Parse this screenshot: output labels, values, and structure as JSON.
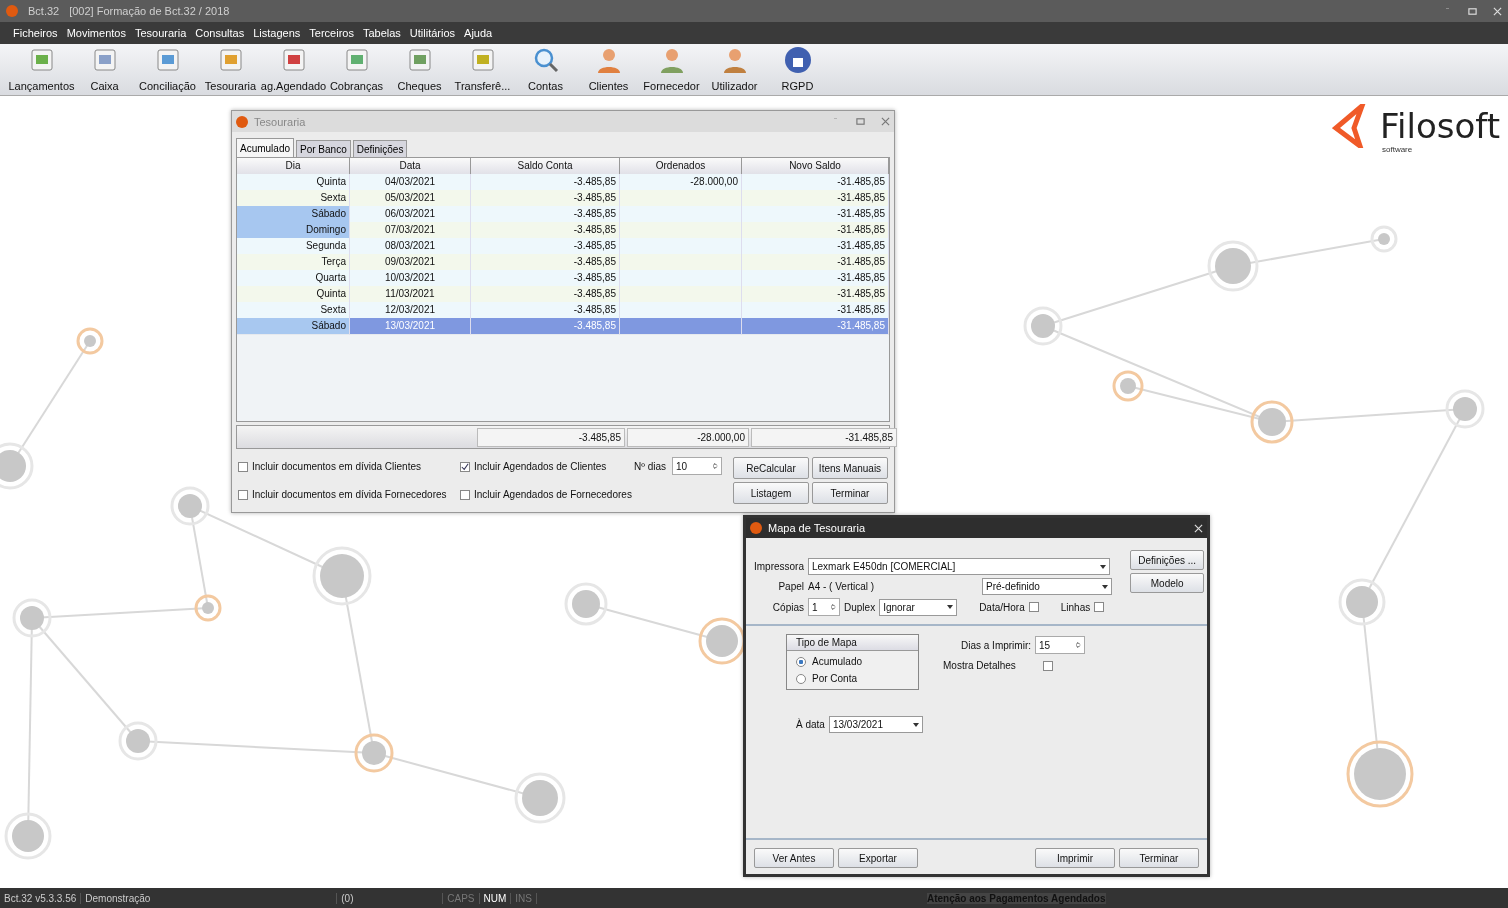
{
  "app_title": {
    "app": "Bct.32",
    "company": "[002]  Formação de Bct.32 / 2018"
  },
  "menu": [
    "Ficheiros",
    "Movimentos",
    "Tesouraria",
    "Consultas",
    "Listagens",
    "Terceiros",
    "Tabelas",
    "Utilitários",
    "Ajuda"
  ],
  "toolbar": [
    "Lançamentos",
    "Caixa",
    "Conciliação",
    "Tesouraria",
    "ag.Agendado",
    "Cobranças",
    "Cheques",
    "Transferê...",
    "Contas",
    "Clientes",
    "Fornecedor",
    "Utilizador",
    "RGPD"
  ],
  "logo": {
    "name": "Filosoft",
    "tagline": "software"
  },
  "tesouraria": {
    "title": "Tesouraria",
    "tabs": [
      {
        "label": "Acumulado",
        "selected": true
      },
      {
        "label": "Por Banco",
        "selected": false
      },
      {
        "label": "Definições",
        "selected": false
      }
    ],
    "columns": [
      "Dia",
      "Data",
      "Saldo Conta",
      "Ordenados",
      "Novo Saldo"
    ],
    "rows": [
      {
        "dia": "Quinta",
        "data": "04/03/2021",
        "saldo": "-3.485,85",
        "ordenados": "-28.000,00",
        "novo": "-31.485,85",
        "weekend": false,
        "selected": false
      },
      {
        "dia": "Sexta",
        "data": "05/03/2021",
        "saldo": "-3.485,85",
        "novo": "-31.485,85",
        "weekend": false,
        "selected": false
      },
      {
        "dia": "Sábado",
        "data": "06/03/2021",
        "saldo": "-3.485,85",
        "novo": "-31.485,85",
        "weekend": true,
        "selected": false
      },
      {
        "dia": "Domingo",
        "data": "07/03/2021",
        "saldo": "-3.485,85",
        "novo": "-31.485,85",
        "weekend": true,
        "selected": false
      },
      {
        "dia": "Segunda",
        "data": "08/03/2021",
        "saldo": "-3.485,85",
        "novo": "-31.485,85",
        "weekend": false,
        "selected": false
      },
      {
        "dia": "Terça",
        "data": "09/03/2021",
        "saldo": "-3.485,85",
        "novo": "-31.485,85",
        "weekend": false,
        "selected": false
      },
      {
        "dia": "Quarta",
        "data": "10/03/2021",
        "saldo": "-3.485,85",
        "novo": "-31.485,85",
        "weekend": false,
        "selected": false
      },
      {
        "dia": "Quinta",
        "data": "11/03/2021",
        "saldo": "-3.485,85",
        "novo": "-31.485,85",
        "weekend": false,
        "selected": false
      },
      {
        "dia": "Sexta",
        "data": "12/03/2021",
        "saldo": "-3.485,85",
        "novo": "-31.485,85",
        "weekend": false,
        "selected": false
      },
      {
        "dia": "Sábado",
        "data": "13/03/2021",
        "saldo": "-3.485,85",
        "novo": "-31.485,85",
        "weekend": true,
        "selected": true
      }
    ],
    "totals": [
      "-3.485,85",
      "-28.000,00",
      "-31.485,85"
    ],
    "options": [
      {
        "label": "Incluir documentos em dívida Clientes",
        "checked": false
      },
      {
        "label": "Incluir Agendados de Clientes",
        "checked": true
      },
      {
        "label": "Incluir documentos em dívida Fornecedores",
        "checked": false
      },
      {
        "label": "Incluir Agendados de Fornecedores",
        "checked": false
      }
    ],
    "ndias": {
      "label": "Nº dias",
      "value": "10"
    },
    "buttons": [
      "ReCalcular",
      "Itens Manuais",
      "Listagem",
      "Terminar"
    ]
  },
  "mapa": {
    "title": "Mapa de Tesouraria",
    "impressora": {
      "label": "Impressora",
      "value": "Lexmark E450dn [COMERCIAL]"
    },
    "papel": {
      "label": "Papel",
      "value": "A4  -  ( Vertical )"
    },
    "modo": {
      "value": "Pré-definido"
    },
    "copias": {
      "label": "Cópias",
      "value": "1"
    },
    "duplex": {
      "label": "Duplex",
      "value": "Ignorar"
    },
    "checks": [
      {
        "label": "Data/Hora",
        "checked": false
      },
      {
        "label": "Linhas",
        "checked": false
      }
    ],
    "side_buttons": [
      "Definições ...",
      "Modelo"
    ],
    "tipo": {
      "title": "Tipo de Mapa",
      "options": [
        {
          "label": "Acumulado",
          "selected": true
        },
        {
          "label": "Por Conta",
          "selected": false
        }
      ]
    },
    "dias": {
      "label": "Dias a Imprimir:",
      "value": "15"
    },
    "detalhes": {
      "label": "Mostra Detalhes",
      "checked": false
    },
    "data": {
      "label": "À data",
      "value": "13/03/2021"
    },
    "buttons_left": [
      "Ver Antes",
      "Exportar"
    ],
    "buttons_right": [
      "Imprimir",
      "Terminar"
    ]
  },
  "status_bar": {
    "version": "Bct.32  v5.3.3.56",
    "mode": "Demonstração",
    "count": "(0)",
    "keys": [
      {
        "label": "CAPS",
        "on": false
      },
      {
        "label": "NUM",
        "on": true
      },
      {
        "label": "INS",
        "on": false
      }
    ],
    "message": "Atenção aos Pagamentos Agendados"
  }
}
